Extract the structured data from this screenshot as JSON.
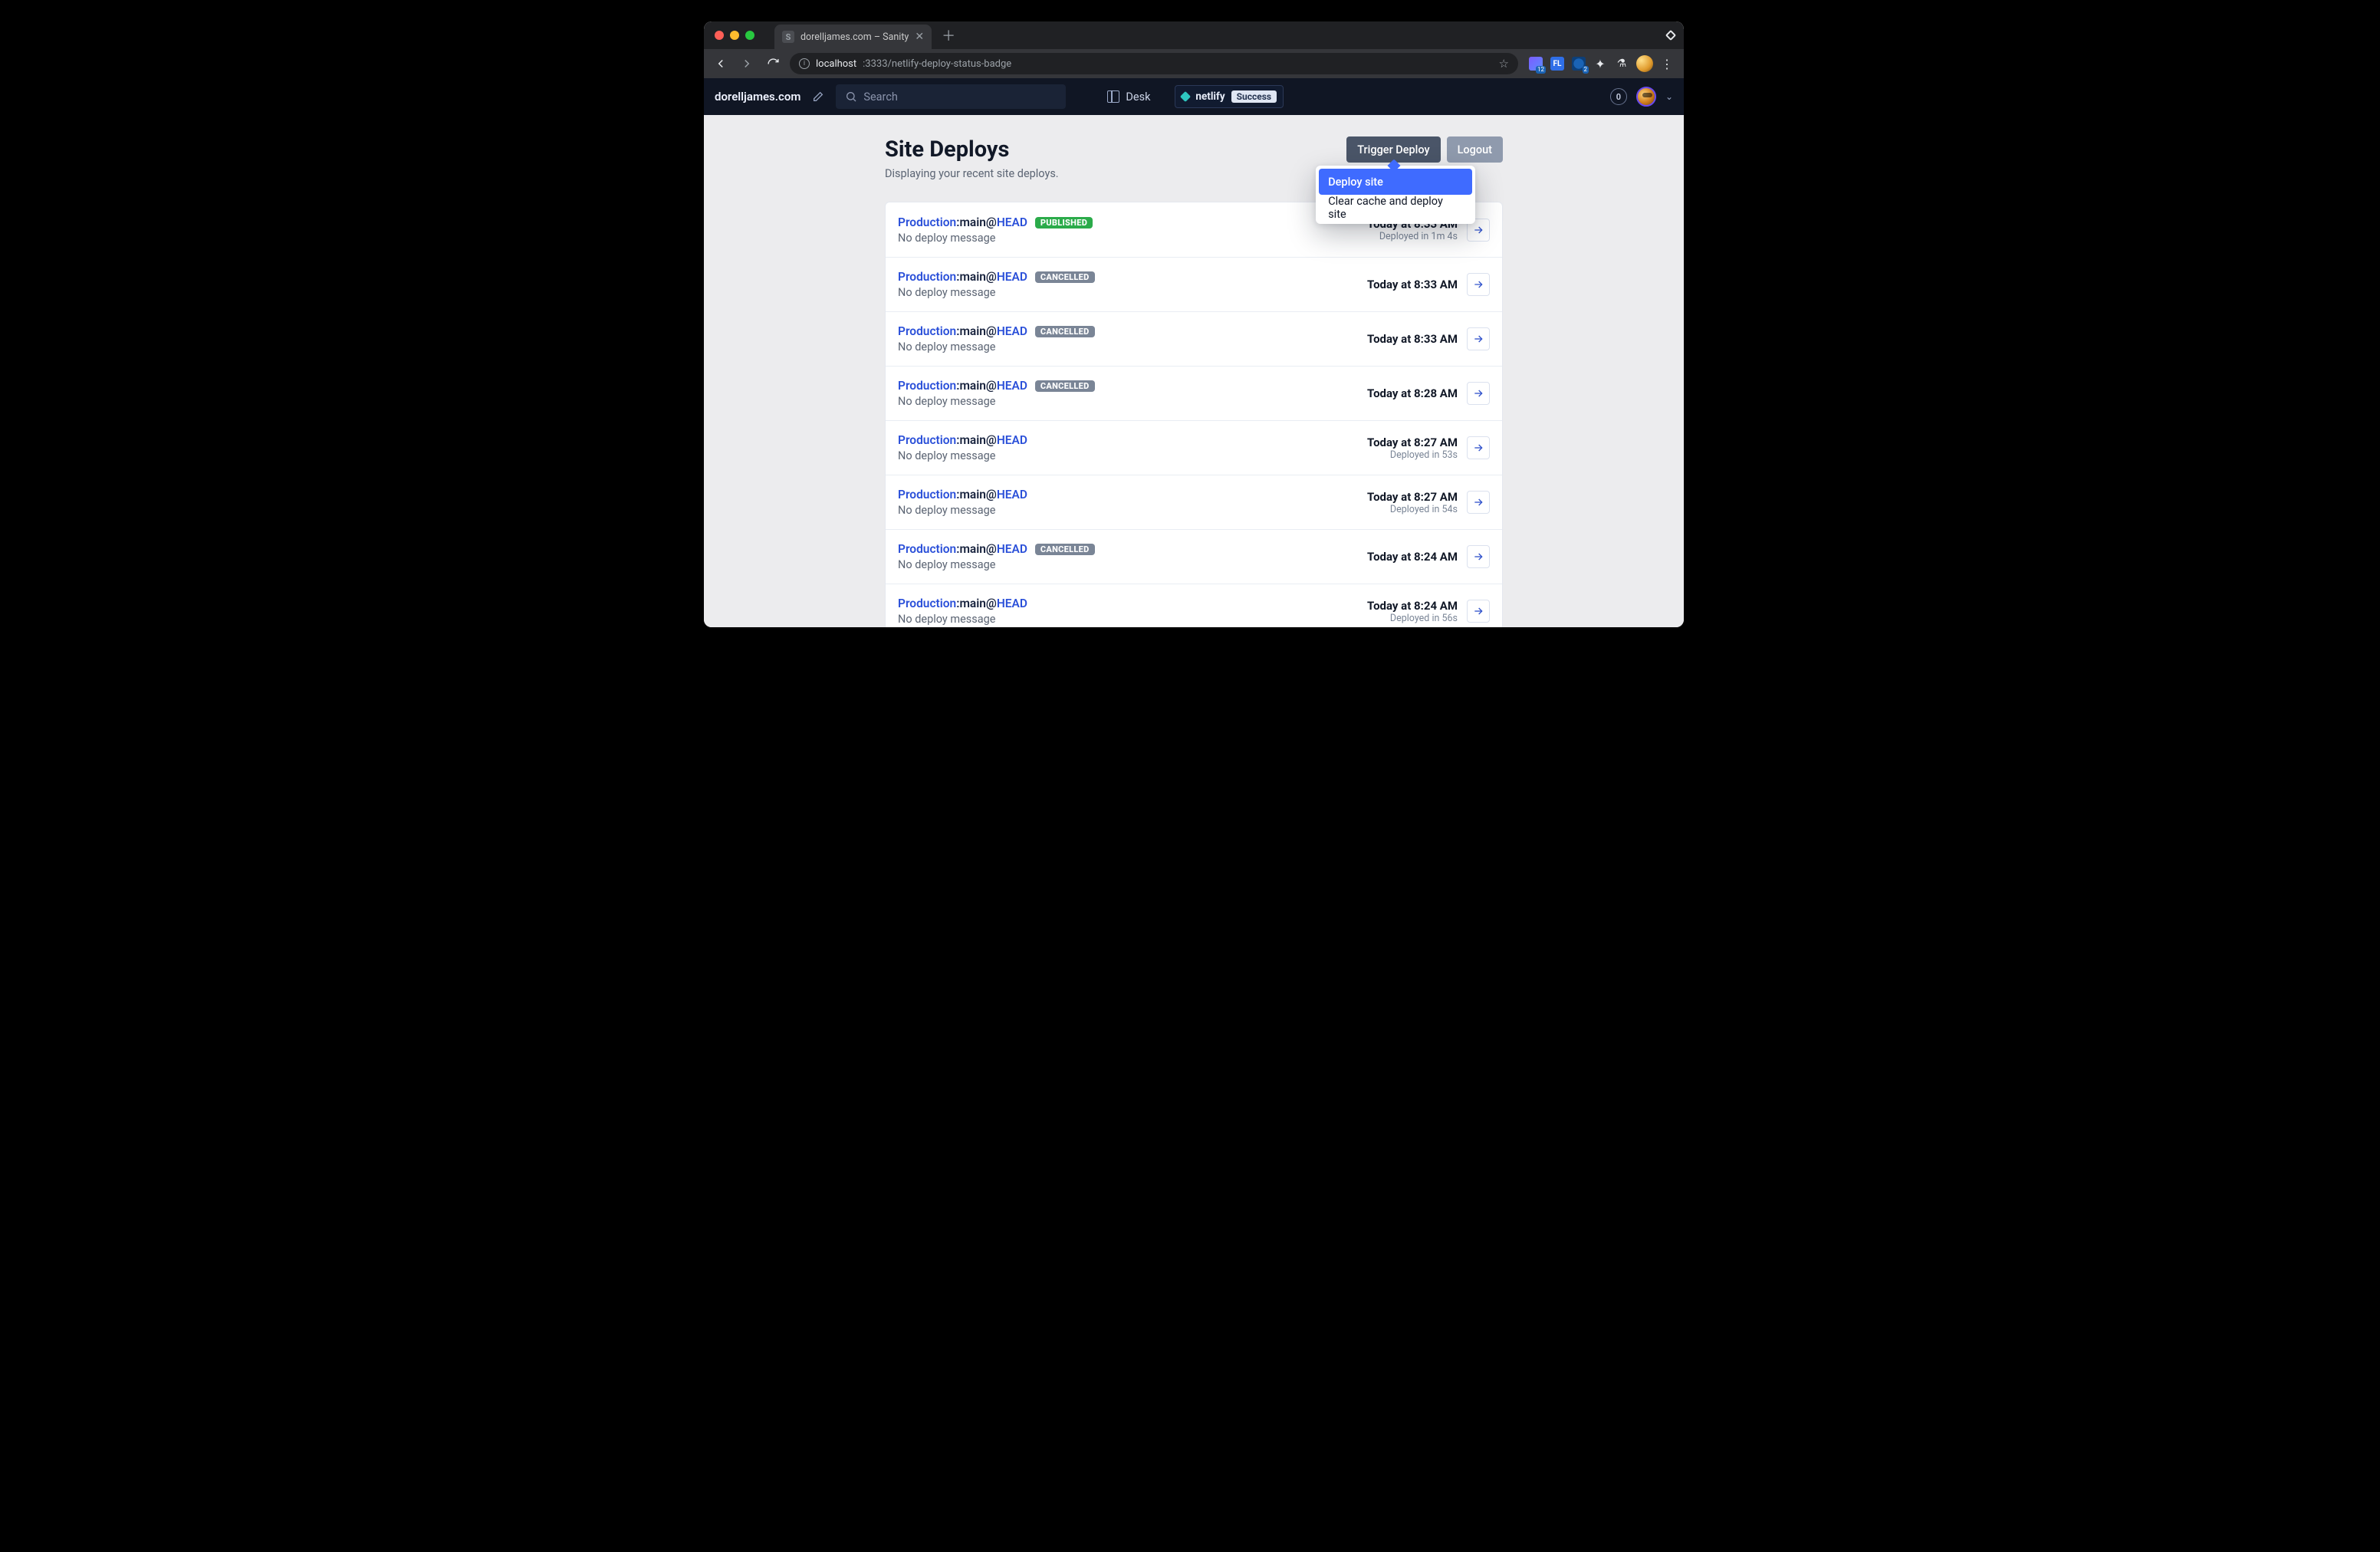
{
  "browser": {
    "tab_title": "dorelljames.com – Sanity",
    "url_host": "localhost",
    "url_port_path": ":3333/netlify-deploy-status-badge"
  },
  "appbar": {
    "site_name": "dorelljames.com",
    "search_placeholder": "Search",
    "desk_label": "Desk",
    "netlify_label": "netlify",
    "netlify_status": "Success",
    "notif_count": "0"
  },
  "page": {
    "title": "Site Deploys",
    "subtitle": "Displaying your recent site deploys.",
    "trigger_label": "Trigger Deploy",
    "logout_label": "Logout"
  },
  "dropdown": {
    "item1": "Deploy site",
    "item2": "Clear cache and deploy site"
  },
  "pills": {
    "published": "PUBLISHED",
    "cancelled": "CANCELLED"
  },
  "row_common": {
    "env": "Production",
    "branch": "main",
    "ref": "HEAD",
    "no_msg": "No deploy message"
  },
  "deploys": [
    {
      "badge": "published",
      "time": "Today at 8:33 AM",
      "sub": "Deployed in 1m 4s"
    },
    {
      "badge": "cancelled",
      "time": "Today at 8:33 AM",
      "sub": ""
    },
    {
      "badge": "cancelled",
      "time": "Today at 8:33 AM",
      "sub": ""
    },
    {
      "badge": "cancelled",
      "time": "Today at 8:28 AM",
      "sub": ""
    },
    {
      "badge": "",
      "time": "Today at 8:27 AM",
      "sub": "Deployed in 53s"
    },
    {
      "badge": "",
      "time": "Today at 8:27 AM",
      "sub": "Deployed in 54s"
    },
    {
      "badge": "cancelled",
      "time": "Today at 8:24 AM",
      "sub": ""
    },
    {
      "badge": "",
      "time": "Today at 8:24 AM",
      "sub": "Deployed in 56s"
    }
  ]
}
